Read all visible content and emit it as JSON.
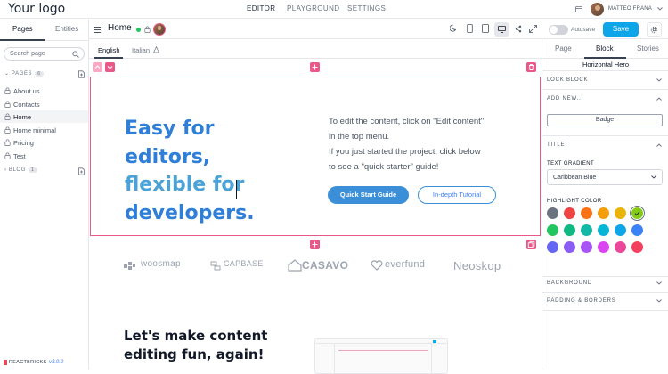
{
  "app": {
    "logo": "Your logo",
    "brand": "REACTBRICKS",
    "version": "v3.9.2"
  },
  "topnav": {
    "items": [
      "EDITOR",
      "PLAYGROUND",
      "SETTINGS"
    ]
  },
  "user": {
    "name": "MATTEO FRANA"
  },
  "left_sidebar": {
    "tabs": [
      "Pages",
      "Entities"
    ],
    "search_placeholder": "Search page",
    "pages_section": {
      "label": "PAGES",
      "count": "6"
    },
    "pages": [
      "About us",
      "Contacts",
      "Home",
      "Home minimal",
      "Pricing",
      "Test"
    ],
    "active_page": "Home",
    "blog_section": {
      "label": "BLOG",
      "count": "1"
    }
  },
  "toolbar": {
    "page_title": "Home",
    "autosave_label": "Autosave",
    "save_label": "Save",
    "icons": [
      "menu-icon",
      "status-dot-icon",
      "lock-icon",
      "moon-icon",
      "mobile-icon",
      "tablet-icon",
      "desktop-icon",
      "share-icon",
      "expand-icon",
      "gear-icon"
    ]
  },
  "languages": {
    "items": [
      "English",
      "Italian"
    ],
    "active": "English"
  },
  "hero": {
    "heading_lines": [
      "Easy for editors,",
      "flexible for",
      "developers."
    ],
    "text_lines": [
      "To edit the content, click on \"Edit content\"",
      "in the top menu.",
      "If you just started the project, click below",
      "to see a \"quick starter\" guide!"
    ],
    "primary_button": "Quick Start Guide",
    "secondary_button": "In-depth Tutorial"
  },
  "customers": {
    "logos": [
      "woosmap",
      "CAPBASE",
      "CASAVO",
      "everfund",
      "Neoskop"
    ]
  },
  "section2": {
    "title_lines": [
      "Let's make content",
      "editing fun, again!"
    ]
  },
  "right_sidebar": {
    "tabs": [
      "Page",
      "Block",
      "Stories"
    ],
    "active_tab": "Block",
    "block_name": "Horizontal Hero",
    "sections": {
      "lock_block": "LOCK BLOCK",
      "add_new": "ADD NEW...",
      "title": "TITLE",
      "background": "BACKGROUND",
      "padding": "PADDING & BORDERS"
    },
    "add_badge_label": "Badge",
    "text_gradient_label": "TEXT GRADIENT",
    "text_gradient_value": "Caribbean Blue",
    "highlight_color_label": "HIGHLIGHT COLOR",
    "highlight_colors": [
      "#6b7280",
      "#ef4444",
      "#f97316",
      "#f59e0b",
      "#eab308",
      "#84cc16",
      "#22c55e",
      "#10b981",
      "#14b8a6",
      "#06b6d4",
      "#0ea5e9",
      "#3b82f6",
      "#6366f1",
      "#8b5cf6",
      "#a855f7",
      "#d946ef",
      "#ec4899",
      "#f43f5e"
    ],
    "selected_highlight": "#84cc16"
  },
  "colors": {
    "accent": "#0ea5e9",
    "block_outline": "#e8598a",
    "heading_gradient": [
      "#2f7fd8",
      "#49a2d8"
    ]
  }
}
